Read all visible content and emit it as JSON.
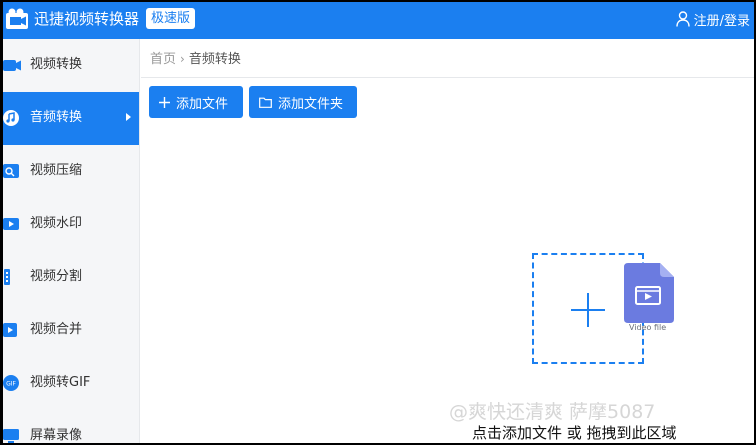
{
  "app": {
    "title": "迅捷视频转换器",
    "badge": "极速版",
    "user_label": "注册/登录"
  },
  "sidebar": {
    "items": [
      {
        "label": "视频转换",
        "icon": "video-convert-icon",
        "active": false
      },
      {
        "label": "音频转换",
        "icon": "audio-convert-icon",
        "active": true
      },
      {
        "label": "视频压缩",
        "icon": "video-compress-icon",
        "active": false
      },
      {
        "label": "视频水印",
        "icon": "video-watermark-icon",
        "active": false
      },
      {
        "label": "视频分割",
        "icon": "video-split-icon",
        "active": false
      },
      {
        "label": "视频合并",
        "icon": "video-merge-icon",
        "active": false
      },
      {
        "label": "视频转GIF",
        "icon": "gif-icon",
        "active": false
      },
      {
        "label": "屏幕录像",
        "icon": "screen-record-icon",
        "active": false
      }
    ]
  },
  "breadcrumb": {
    "home": "首页",
    "separator": "›",
    "current": "音频转换"
  },
  "toolbar": {
    "add_file_label": "添加文件",
    "add_folder_label": "添加文件夹"
  },
  "dropzone": {
    "file_caption": "Video file",
    "hint": "点击添加文件 或 拖拽到此区域"
  },
  "watermark": "@爽快还清爽 萨摩5087",
  "colors": {
    "accent": "#1b7ff0",
    "file_icon": "#6b7be0",
    "sidebar_bg": "#f5f6f8"
  }
}
